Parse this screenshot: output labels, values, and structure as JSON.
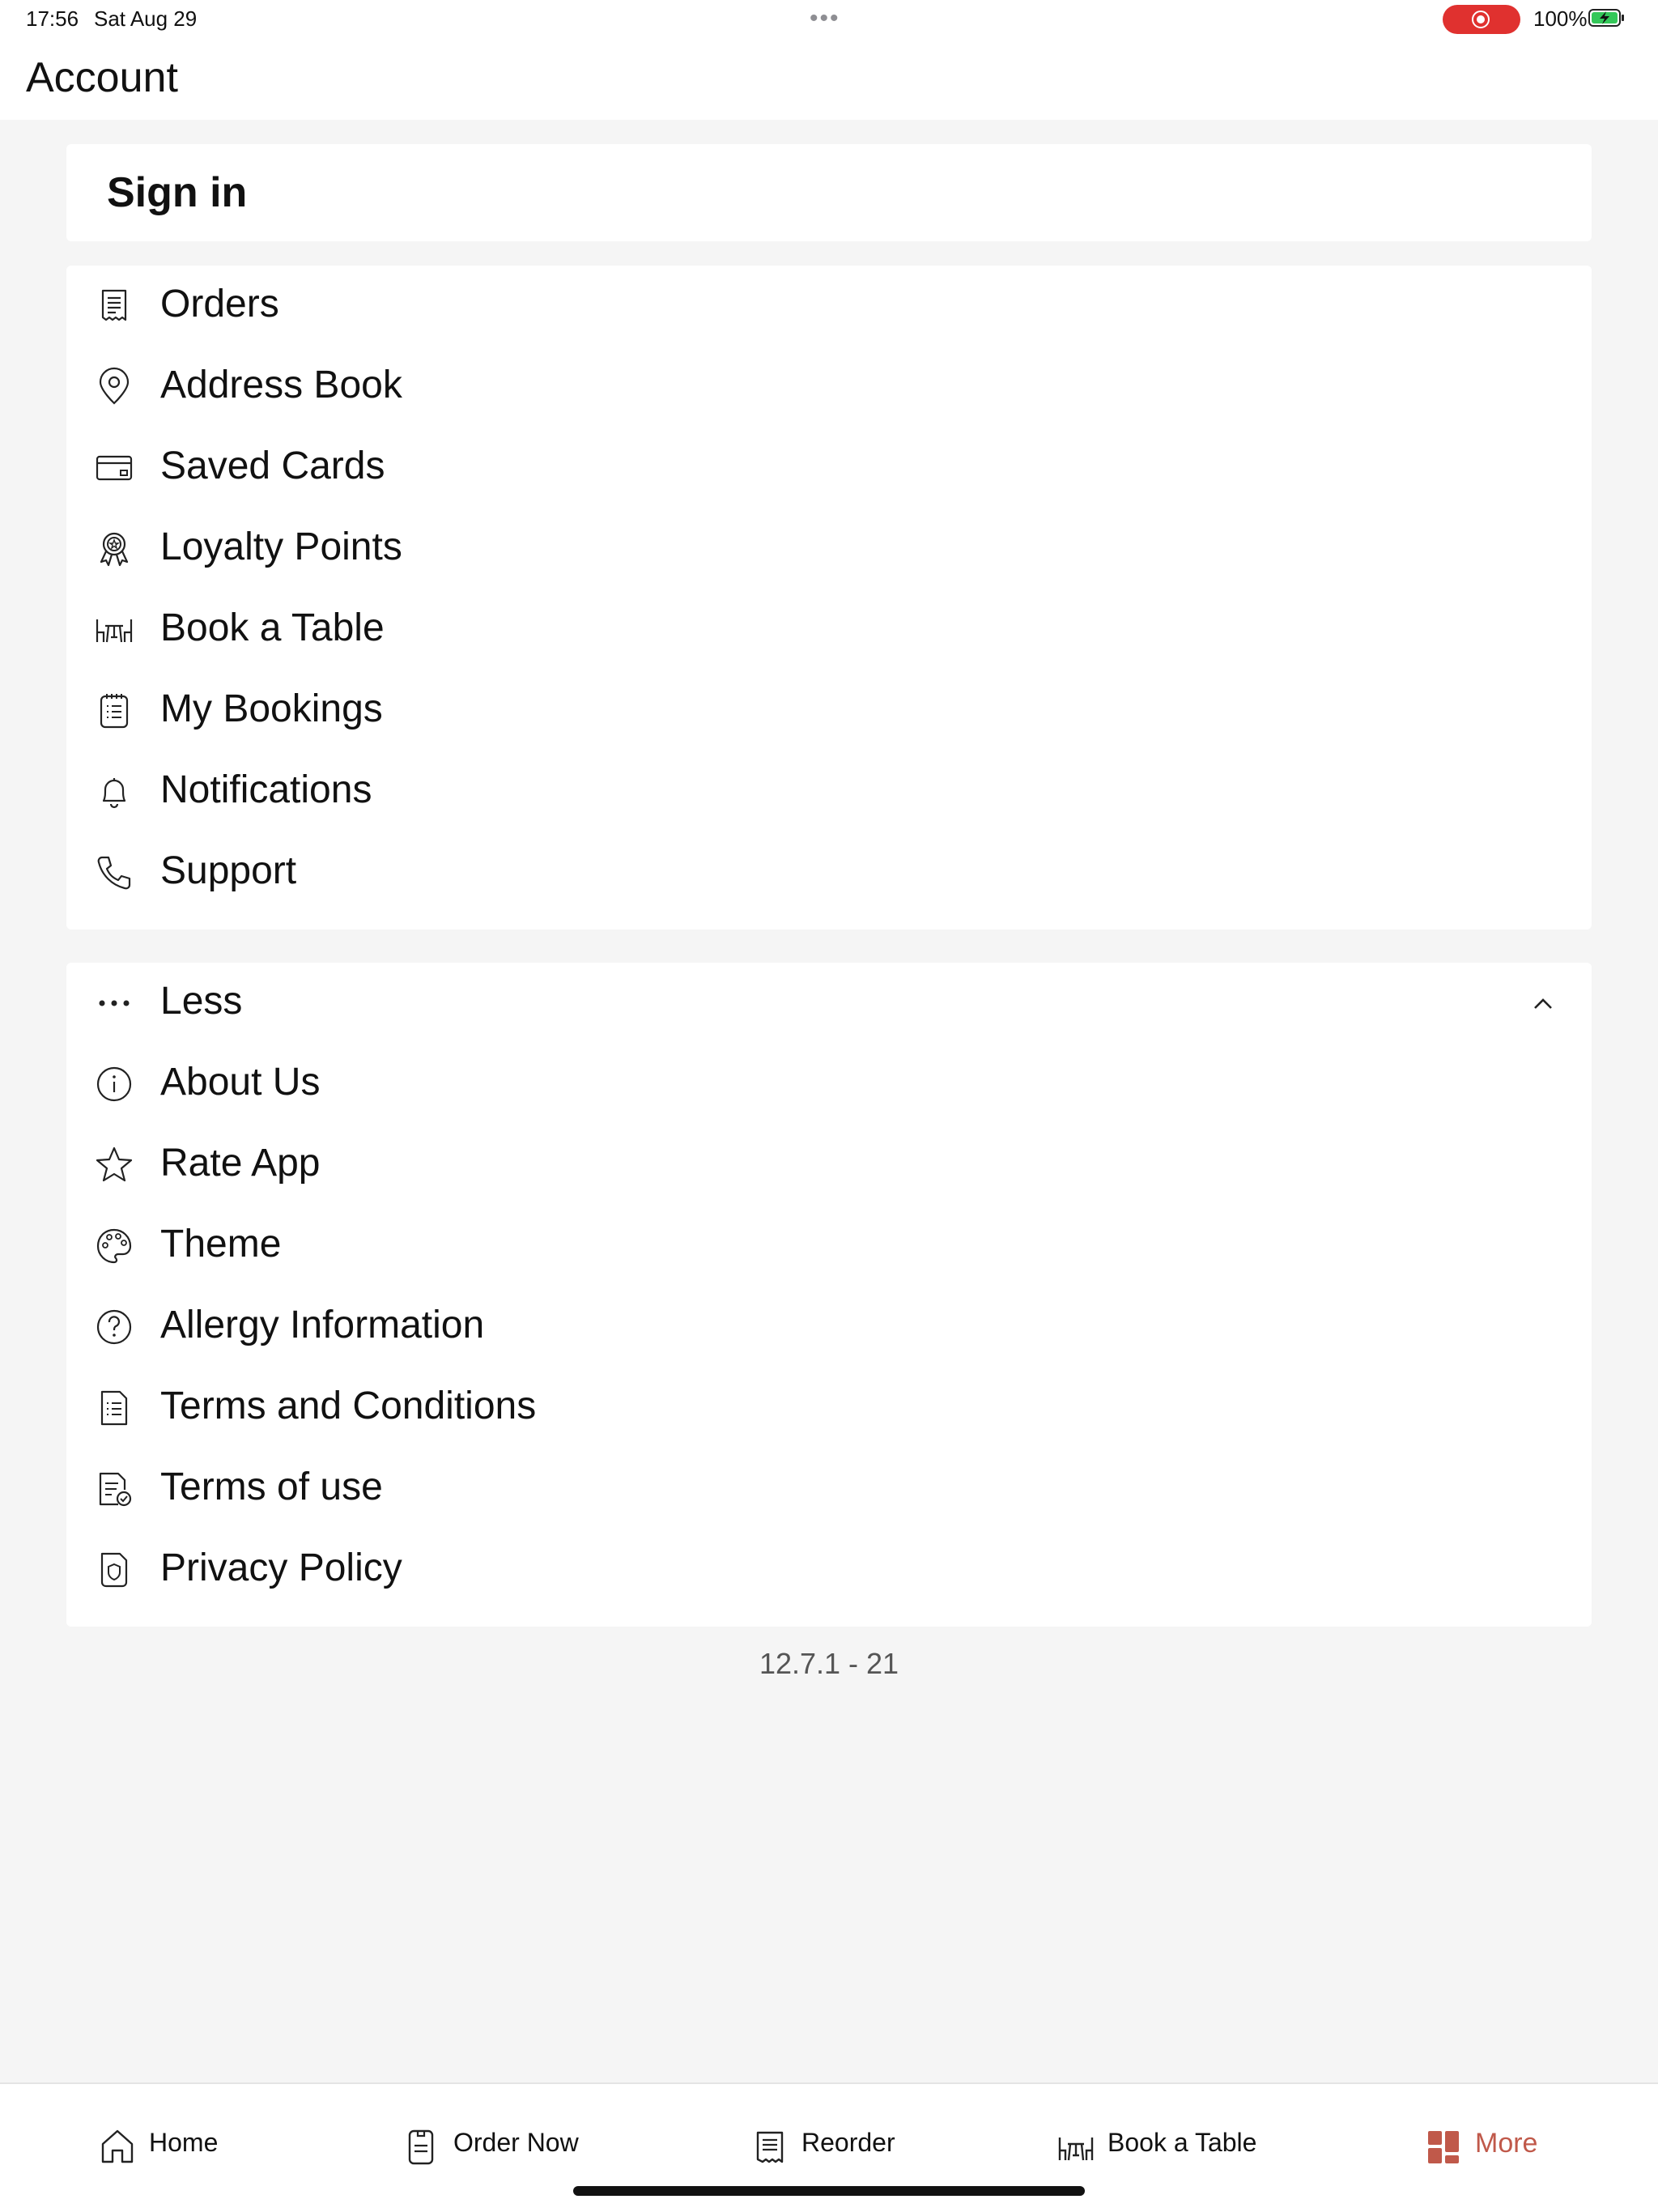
{
  "status_bar": {
    "time": "17:56",
    "date": "Sat Aug 29",
    "battery_percent": "100%",
    "battery_level": 1.0,
    "recording_color": "#e0312f",
    "battery_color": "#34c759"
  },
  "header": {
    "title": "Account"
  },
  "sign_in": {
    "label": "Sign in"
  },
  "menu_main": [
    {
      "label": "Orders",
      "icon": "receipt-icon"
    },
    {
      "label": "Address Book",
      "icon": "map-pin-icon"
    },
    {
      "label": "Saved Cards",
      "icon": "credit-card-icon"
    },
    {
      "label": "Loyalty Points",
      "icon": "award-ribbon-icon"
    },
    {
      "label": "Book a Table",
      "icon": "table-chairs-icon"
    },
    {
      "label": "My Bookings",
      "icon": "notepad-list-icon"
    },
    {
      "label": "Notifications",
      "icon": "bell-icon"
    },
    {
      "label": "Support",
      "icon": "phone-icon"
    }
  ],
  "menu_more": {
    "toggle_label": "Less",
    "items": [
      {
        "label": "About Us",
        "icon": "info-circle-icon"
      },
      {
        "label": "Rate App",
        "icon": "star-icon"
      },
      {
        "label": "Theme",
        "icon": "palette-icon"
      },
      {
        "label": "Allergy Information",
        "icon": "question-circle-icon"
      },
      {
        "label": "Terms and Conditions",
        "icon": "document-list-icon"
      },
      {
        "label": "Terms of use",
        "icon": "document-check-icon"
      },
      {
        "label": "Privacy Policy",
        "icon": "shield-document-icon"
      }
    ]
  },
  "version": "12.7.1 - 21",
  "tabbar": {
    "accent_color": "#c0594a",
    "tabs": [
      {
        "label": "Home",
        "icon": "home-icon"
      },
      {
        "label": "Order Now",
        "icon": "order-doc-icon"
      },
      {
        "label": "Reorder",
        "icon": "receipt-icon"
      },
      {
        "label": "Book a Table",
        "icon": "table-chairs-icon"
      },
      {
        "label": "More",
        "icon": "grid-icon",
        "active": true
      }
    ]
  }
}
